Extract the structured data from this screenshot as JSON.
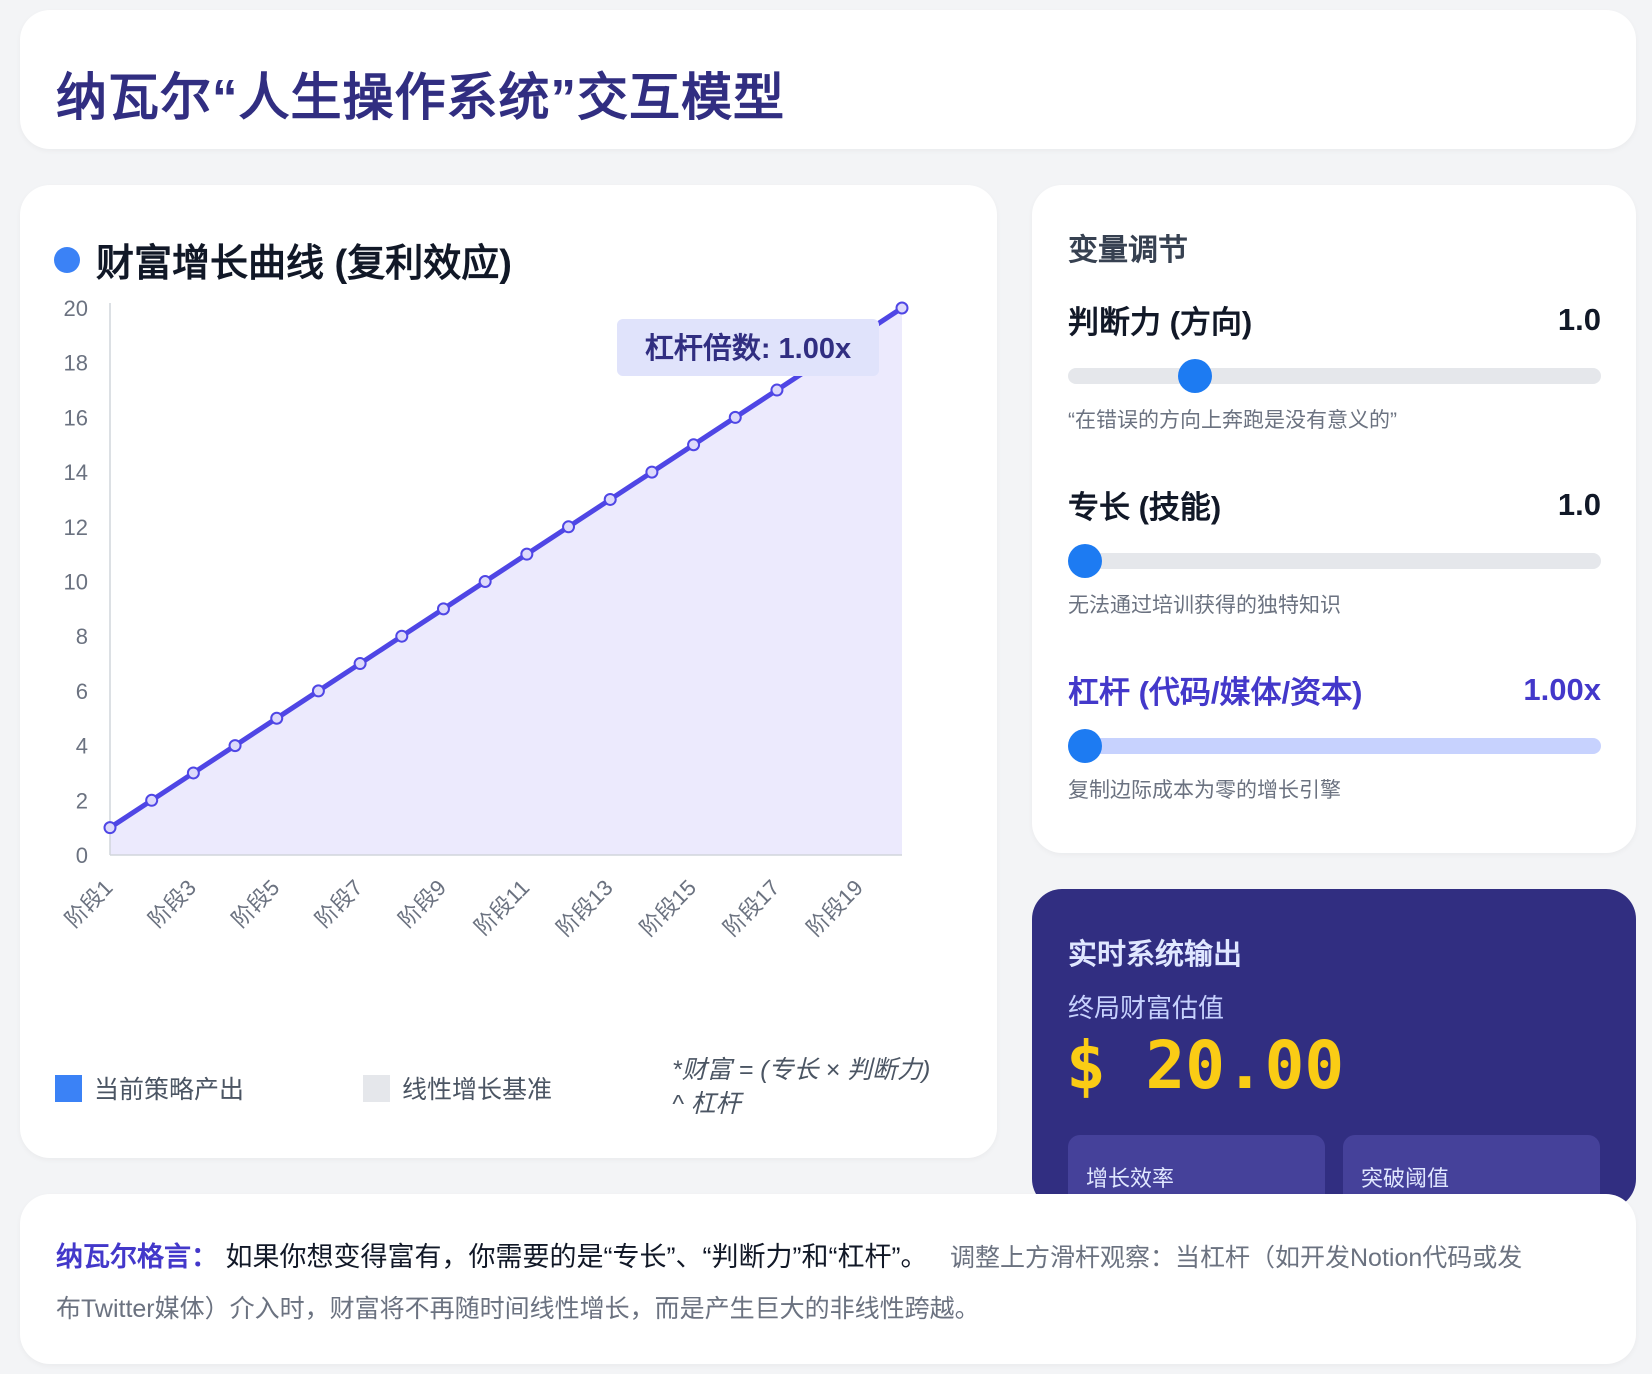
{
  "page": {
    "title": "纳瓦尔“人生操作系统”交互模型"
  },
  "chart_panel": {
    "title": "财富增长曲线 (复利效应)",
    "badge": "杠杆倍数: 1.00x",
    "legend": [
      {
        "label": "当前策略产出",
        "color": "#3b82f6"
      },
      {
        "label": "线性增长基准",
        "color": "#e5e7eb"
      }
    ],
    "formula_line1": "*财富 = (专长 × 判断力)",
    "formula_line2": "^ 杠杆"
  },
  "chart_data": {
    "type": "line",
    "title": "",
    "categories": [
      "阶段1",
      "阶段2",
      "阶段3",
      "阶段4",
      "阶段5",
      "阶段6",
      "阶段7",
      "阶段8",
      "阶段9",
      "阶段10",
      "阶段11",
      "阶段12",
      "阶段13",
      "阶段14",
      "阶段15",
      "阶段16",
      "阶段17",
      "阶段18",
      "阶段19",
      "阶段20"
    ],
    "visible_tick_labels": [
      "阶段1",
      "阶段3",
      "阶段5",
      "阶段7",
      "阶段9",
      "阶段11",
      "阶段13",
      "阶段15",
      "阶段17",
      "阶段19"
    ],
    "series": [
      {
        "name": "当前策略产出",
        "values": [
          1,
          2,
          3,
          4,
          5,
          6,
          7,
          8,
          9,
          10,
          11,
          12,
          13,
          14,
          15,
          16,
          17,
          18,
          19,
          20
        ],
        "color": "#4f46e5",
        "fill": "#eceafd"
      }
    ],
    "yticks": [
      0,
      2,
      4,
      6,
      8,
      10,
      12,
      14,
      16,
      18,
      20
    ],
    "ylim": [
      0,
      20
    ],
    "grid": false,
    "legend": "bottom"
  },
  "controls": {
    "title": "变量调节",
    "sliders": [
      {
        "label": "判断力 (方向)",
        "value_text": "1.0",
        "fraction": 0.22,
        "desc": "“在错误的方向上奔跑是没有意义的”"
      },
      {
        "label": "专长 (技能)",
        "value_text": "1.0",
        "fraction": 0.0,
        "desc": "无法通过培训获得的独特知识"
      },
      {
        "label": "杠杆 (代码/媒体/资本)",
        "value_text": "1.00x",
        "fraction": 0.0,
        "desc": "复制边际成本为零的增长引擎"
      }
    ]
  },
  "output": {
    "title": "实时系统输出",
    "wealth_label": "终局财富估值",
    "wealth_value": "$ 20.00",
    "metrics": [
      "增长效率",
      "突破阈值"
    ]
  },
  "quote": {
    "label": "纳瓦尔格言：",
    "text": "如果你想变得富有，你需要的是“专长”、“判断力”和“杠杆”。",
    "note": "调整上方滑杆观察：当杠杆（如开发Notion代码或发布Twitter媒体）介入时，财富将不再随时间线性增长，而是产生巨大的非线性跨越。"
  }
}
